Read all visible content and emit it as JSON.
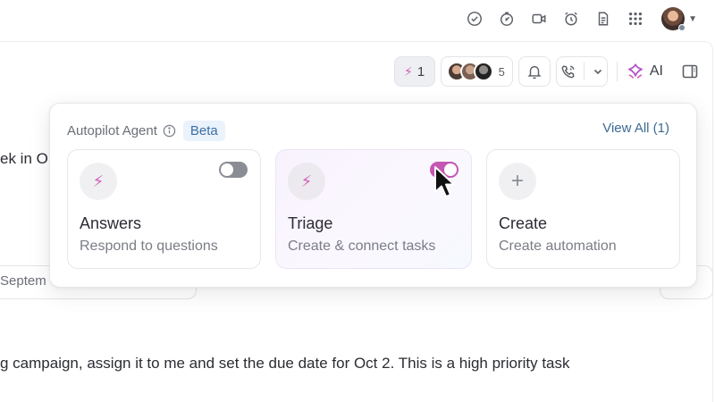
{
  "header": {
    "icons": [
      "check-circle-icon",
      "timer-icon",
      "video-icon",
      "alarm-icon",
      "document-icon",
      "apps-grid-icon"
    ]
  },
  "toolbar": {
    "autopilot_count": "1",
    "watchers_count": "5",
    "ai_label": "AI"
  },
  "background": {
    "line1": "ek in O",
    "pill_text": "Septem",
    "line2": "g campaign, assign it to me and set the due date for Oct 2. This is a high priority task"
  },
  "popover": {
    "title": "Autopilot Agent",
    "badge": "Beta",
    "view_all": "View All (1)",
    "cards": [
      {
        "title": "Answers",
        "subtitle": "Respond to questions",
        "icon": "bolt-icon",
        "toggle": false
      },
      {
        "title": "Triage",
        "subtitle": "Create & connect tasks",
        "icon": "bolt-icon",
        "toggle": true
      },
      {
        "title": "Create",
        "subtitle": "Create automation",
        "icon": "plus-icon"
      }
    ]
  },
  "colors": {
    "accent_pink": "#c556b3",
    "bolt": "#d05fb8",
    "beta_bg": "#eaf2fb",
    "beta_text": "#3b6fa5",
    "link": "#3d6a96"
  }
}
